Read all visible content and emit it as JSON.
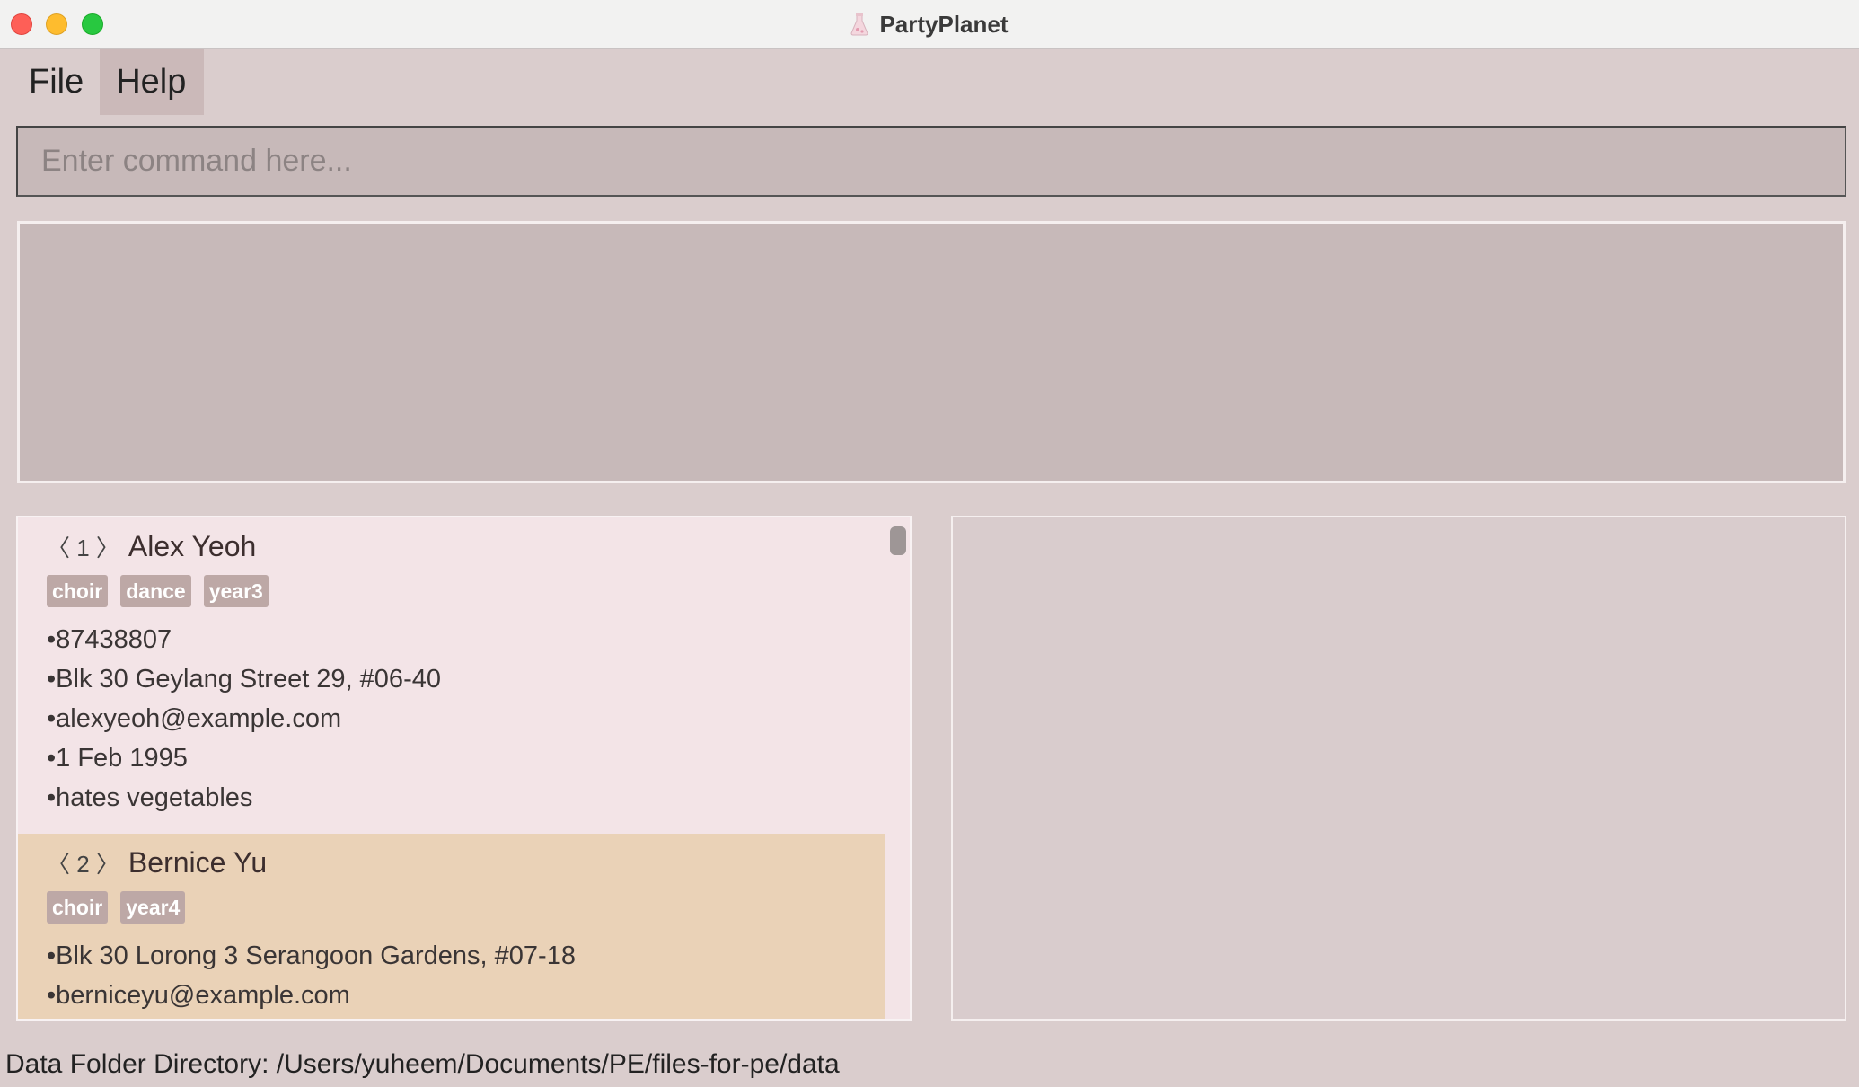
{
  "window": {
    "title": "PartyPlanet"
  },
  "menu": {
    "file_label": "File",
    "help_label": "Help"
  },
  "command": {
    "placeholder": "Enter command here...",
    "value": ""
  },
  "result": {
    "text": ""
  },
  "people": [
    {
      "index": "〈 1 〉",
      "name": "Alex Yeoh",
      "tags": [
        "choir",
        "dance",
        "year3"
      ],
      "phone": "•87438807",
      "address": "•Blk 30 Geylang Street 29, #06-40",
      "email": "•alexyeoh@example.com",
      "birthday": "•1 Feb 1995",
      "remark": "•hates vegetables"
    },
    {
      "index": "〈 2 〉",
      "name": "Bernice Yu",
      "tags": [
        "choir",
        "year4"
      ],
      "address": "•Blk 30 Lorong 3 Serangoon Gardens, #07-18",
      "email": "•berniceyu@example.com"
    }
  ],
  "status": {
    "data_folder": "Data Folder Directory: /Users/yuheem/Documents/PE/files-for-pe/data"
  },
  "colors": {
    "background": "#dacdcd",
    "selected_card": "#ead2b7",
    "tag": "#bda8a6"
  },
  "icons": {
    "app": "party-flask-icon"
  }
}
